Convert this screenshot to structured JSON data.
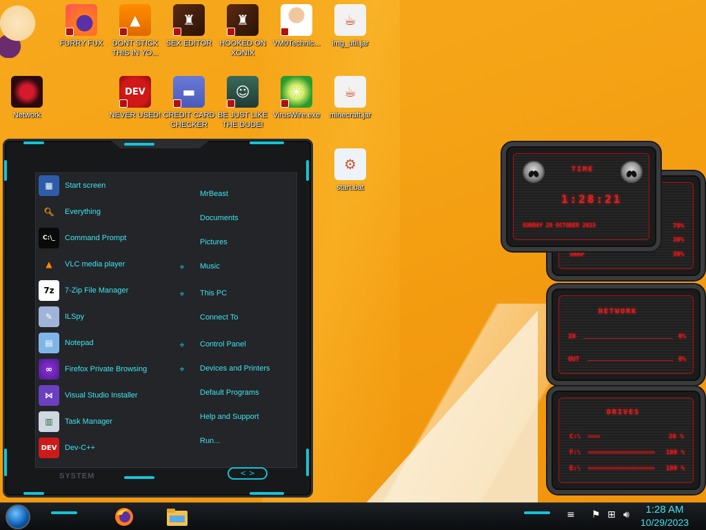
{
  "desktop": {
    "icons": [
      {
        "label": "FURRY FUX",
        "icon": "firefox-icon"
      },
      {
        "label": "DONT STICK THIS IN YO...",
        "icon": "vlc-icon"
      },
      {
        "label": "SEX EDITOR",
        "icon": "book-icon"
      },
      {
        "label": "HOOKED ON XONIX",
        "icon": "book-icon"
      },
      {
        "label": "VM0Technic...",
        "icon": "doctor-icon"
      },
      {
        "label": "img_util.jar",
        "icon": "java-icon"
      },
      {
        "label": "Network",
        "icon": "network-icon"
      },
      {
        "label": "NEVER USED!",
        "icon": "devcpp-icon"
      },
      {
        "label": "CREDIT CARD CHECKER",
        "icon": "credit-card-icon"
      },
      {
        "label": "BE JUST LIKE THE DUDE!",
        "icon": "elf-icon"
      },
      {
        "label": "VirusWire.exe",
        "icon": "lime-icon"
      },
      {
        "label": "minecraft.jar",
        "icon": "java-icon"
      },
      {
        "label": "start.bat",
        "icon": "batch-gear-icon"
      }
    ],
    "accent_color": "#3ee6f2",
    "widget_red": "#d81a1a"
  },
  "start_menu": {
    "left_items": [
      {
        "label": "Start screen",
        "icon": "start-screen-icon"
      },
      {
        "label": "Everything",
        "icon": "magnifier-icon"
      },
      {
        "label": "Command Prompt",
        "icon": "cmd-icon"
      },
      {
        "label": "VLC media player",
        "icon": "vlc-icon"
      },
      {
        "label": "7-Zip File Manager",
        "icon": "7zip-icon"
      },
      {
        "label": "ILSpy",
        "icon": "ilspy-icon"
      },
      {
        "label": "Notepad",
        "icon": "notepad-icon"
      },
      {
        "label": "Firefox Private Browsing",
        "icon": "firefox-private-icon"
      },
      {
        "label": "Visual Studio Installer",
        "icon": "visual-studio-icon"
      },
      {
        "label": "Task Manager",
        "icon": "task-manager-icon"
      },
      {
        "label": "Dev-C++",
        "icon": "devcpp-icon"
      }
    ],
    "right_items": [
      {
        "label": "MrBeast",
        "bullet": false
      },
      {
        "label": "Documents",
        "bullet": false
      },
      {
        "label": "Pictures",
        "bullet": false
      },
      {
        "label": "Music",
        "bullet": true
      },
      {
        "label": "This PC",
        "bullet": true
      },
      {
        "label": "Connect To",
        "bullet": false
      },
      {
        "label": "Control Panel",
        "bullet": true
      },
      {
        "label": "Devices and Printers",
        "bullet": true
      },
      {
        "label": "Default Programs",
        "bullet": false
      },
      {
        "label": "Help and Support",
        "bullet": false
      },
      {
        "label": "Run...",
        "bullet": false
      }
    ],
    "footer_label": "SYSTEM",
    "nav_arrows": "< >"
  },
  "widgets": {
    "time": {
      "title": "TIME",
      "clock": "1:28:21",
      "date": "SUNDAY 29 OCTOBER 2023"
    },
    "system": {
      "values": [
        "79%",
        "30%",
        "30%"
      ],
      "swap_label": "SWAP"
    },
    "network": {
      "title": "NETWORK",
      "in_label": "IN",
      "in_value": "0%",
      "out_label": "OUT",
      "out_value": "0%"
    },
    "drives": {
      "title": "DRIVES",
      "rows": [
        {
          "label": "C:\\",
          "value": "26 %"
        },
        {
          "label": "F:\\",
          "value": "100 %"
        },
        {
          "label": "E:\\",
          "value": "100 %"
        }
      ]
    }
  },
  "taskbar": {
    "pinned": [
      {
        "icon": "firefox-icon"
      },
      {
        "icon": "file-explorer-icon"
      }
    ],
    "clock_time": "1:28 AM",
    "clock_date": "10/29/2023"
  }
}
